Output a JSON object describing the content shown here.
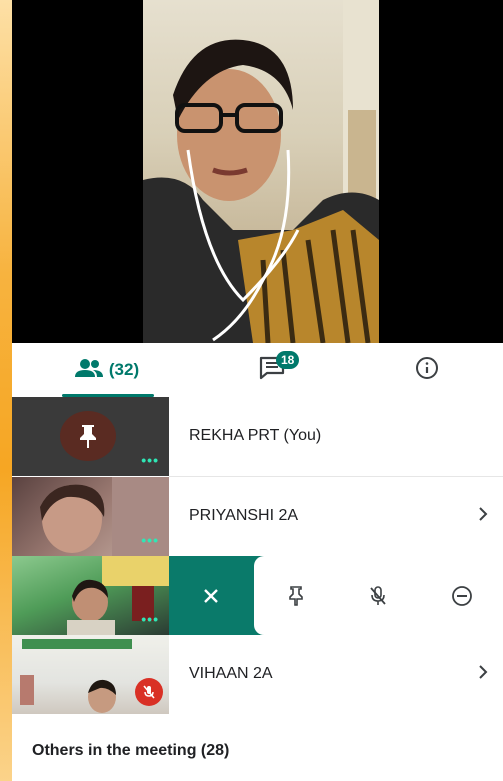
{
  "tabs": {
    "people_count": "(32)",
    "chat_badge": "18"
  },
  "participants": [
    {
      "name": "REKHA PRT (You)"
    },
    {
      "name": "PRIYANSHI 2A"
    },
    {
      "name": ""
    },
    {
      "name": "VIHAAN 2A"
    }
  ],
  "others_label": "Others in the meeting (28)",
  "colors": {
    "accent": "#00796b",
    "mic_off": "#d93025",
    "dots": "#2fe6b5"
  }
}
